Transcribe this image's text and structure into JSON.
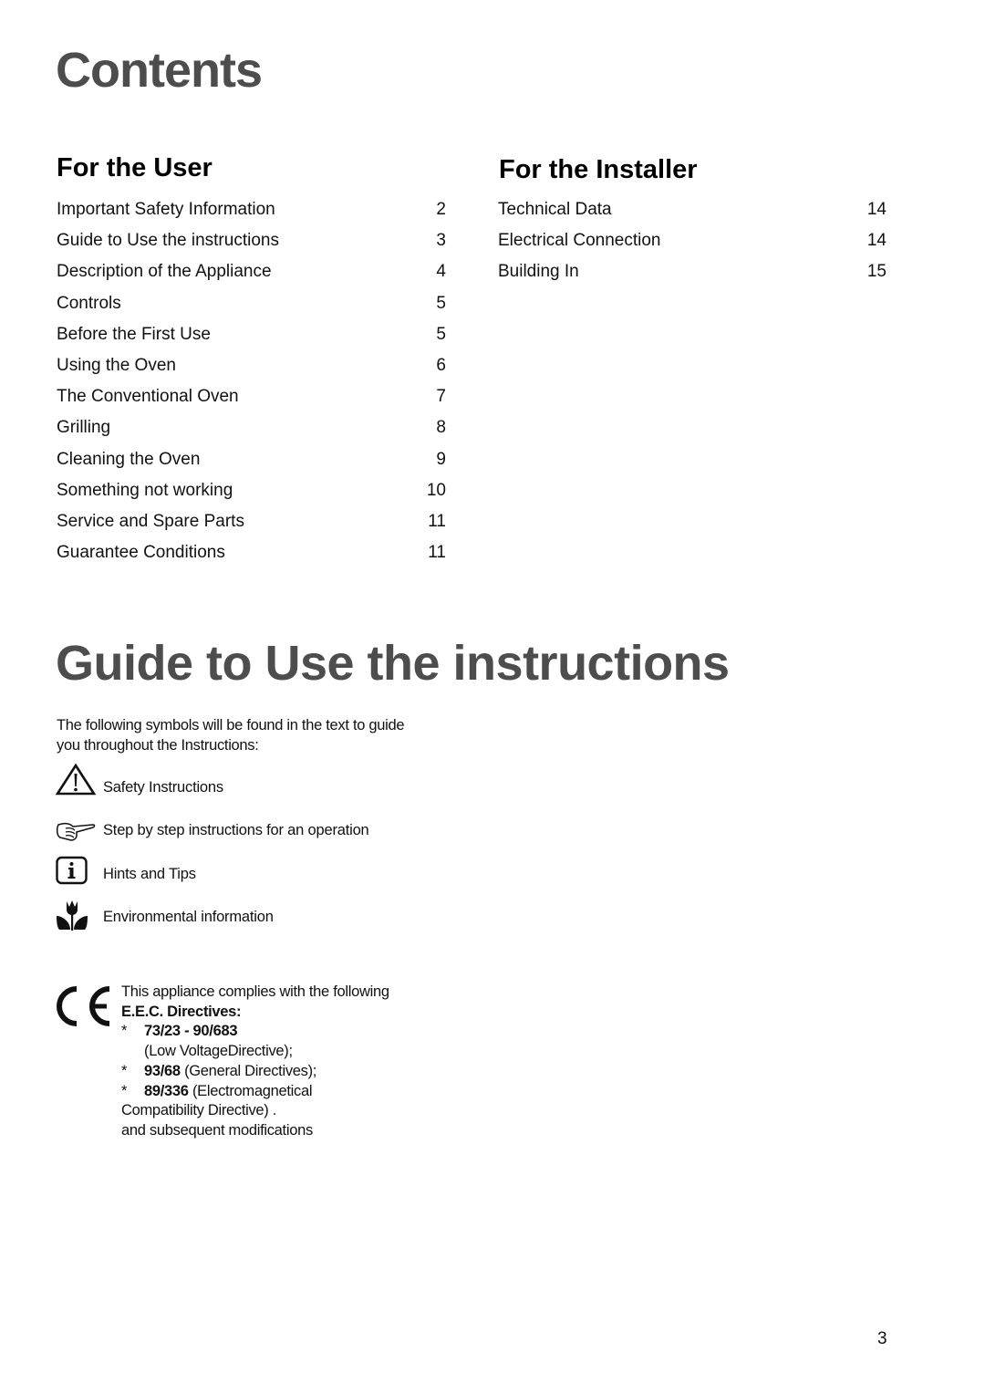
{
  "page": {
    "title": "Contents",
    "page_number": "3"
  },
  "user_section": {
    "heading": "For the User",
    "items": [
      {
        "label": "Important Safety Information",
        "page": "2"
      },
      {
        "label": "Guide to Use the instructions",
        "page": "3"
      },
      {
        "label": "Description of the Appliance",
        "page": "4"
      },
      {
        "label": "Controls",
        "page": "5"
      },
      {
        "label": "Before the First Use",
        "page": "5"
      },
      {
        "label": "Using the Oven",
        "page": "6"
      },
      {
        "label": "The Conventional Oven",
        "page": "7"
      },
      {
        "label": "Grilling",
        "page": "8"
      },
      {
        "label": "Cleaning the Oven",
        "page": "9"
      },
      {
        "label": "Something not working",
        "page": "10"
      },
      {
        "label": "Service and Spare Parts",
        "page": "11"
      },
      {
        "label": "Guarantee Conditions",
        "page": "11"
      }
    ]
  },
  "installer_section": {
    "heading": "For the Installer",
    "items": [
      {
        "label": "Technical Data",
        "page": "14"
      },
      {
        "label": "Electrical Connection",
        "page": "14"
      },
      {
        "label": "Building In",
        "page": "15"
      }
    ]
  },
  "guide": {
    "title": "Guide to Use the instructions",
    "intro_line1": "The following symbols will be found in the text to guide",
    "intro_line2": "you throughout the Instructions:",
    "symbols": [
      {
        "icon": "warning-triangle-icon",
        "label": "Safety Instructions"
      },
      {
        "icon": "pointing-hand-icon",
        "label": "Step by step instructions for an operation"
      },
      {
        "icon": "info-icon",
        "label": "Hints and Tips"
      },
      {
        "icon": "tulip-icon",
        "label": "Environmental information"
      }
    ]
  },
  "compliance": {
    "mark": "CE",
    "line1": "This appliance complies with the following",
    "heading": "E.E.C. Directives:",
    "directive1_code": "73/23 - 90/683",
    "directive1_desc": "(Low VoltageDirective);",
    "directive2_code": "93/68",
    "directive2_desc": " (General Directives);",
    "directive3_code": "89/336",
    "directive3_desc": " (Electromagnetical",
    "directive3_desc_cont": "Compatibility Directive) .",
    "closing": "and subsequent modifications",
    "bullet": "*"
  }
}
